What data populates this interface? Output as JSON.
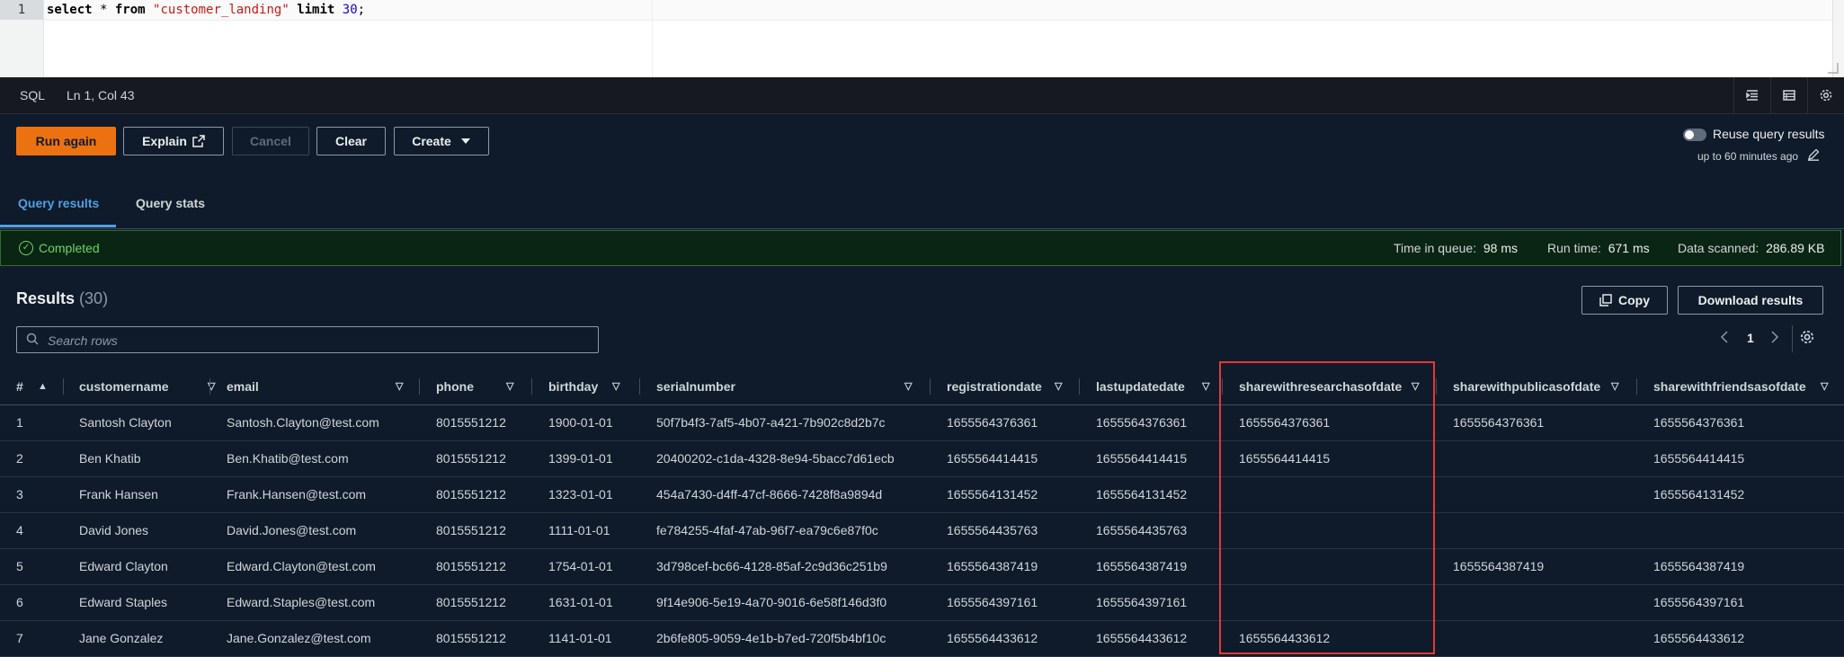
{
  "editor": {
    "line_number": "1",
    "code": {
      "kw1": "select",
      "star": " * ",
      "kw2": "from",
      "space1": " ",
      "table": "\"customer_landing\"",
      "space2": " ",
      "kw3": "limit",
      "space3": " ",
      "num": "30",
      "semi": ";"
    }
  },
  "statusbar": {
    "language": "SQL",
    "position": "Ln 1, Col 43",
    "icons": [
      "indent-icon",
      "table-icon",
      "settings-icon"
    ]
  },
  "toolbar": {
    "run_again": "Run again",
    "explain": "Explain",
    "cancel": "Cancel",
    "clear": "Clear",
    "create": "Create",
    "reuse_label": "Reuse query results",
    "reuse_sub": "up to 60 minutes ago"
  },
  "tabs": [
    {
      "label": "Query results",
      "active": true
    },
    {
      "label": "Query stats",
      "active": false
    }
  ],
  "status": {
    "label": "Completed",
    "queue_label": "Time in queue:",
    "queue_value": "98 ms",
    "run_label": "Run time:",
    "run_value": "671 ms",
    "scanned_label": "Data scanned:",
    "scanned_value": "286.89 KB"
  },
  "results": {
    "title": "Results",
    "count": "(30)",
    "copy": "Copy",
    "download": "Download results",
    "search_placeholder": "Search rows",
    "page": "1"
  },
  "table": {
    "columns": [
      "#",
      "customername",
      "email",
      "phone",
      "birthday",
      "serialnumber",
      "registrationdate",
      "lastupdatedate",
      "sharewithresearchasofdate",
      "sharewithpublicasofdate",
      "sharewithfriendsasofdate"
    ],
    "rows": [
      [
        "1",
        "Santosh Clayton",
        "Santosh.Clayton@test.com",
        "8015551212",
        "1900-01-01",
        "50f7b4f3-7af5-4b07-a421-7b902c8d2b7c",
        "1655564376361",
        "1655564376361",
        "1655564376361",
        "1655564376361",
        "1655564376361"
      ],
      [
        "2",
        "Ben Khatib",
        "Ben.Khatib@test.com",
        "8015551212",
        "1399-01-01",
        "20400202-c1da-4328-8e94-5bacc7d61ecb",
        "1655564414415",
        "1655564414415",
        "1655564414415",
        "",
        "1655564414415"
      ],
      [
        "3",
        "Frank Hansen",
        "Frank.Hansen@test.com",
        "8015551212",
        "1323-01-01",
        "454a7430-d4ff-47cf-8666-7428f8a9894d",
        "1655564131452",
        "1655564131452",
        "",
        "",
        "1655564131452"
      ],
      [
        "4",
        "David Jones",
        "David.Jones@test.com",
        "8015551212",
        "1111-01-01",
        "fe784255-4faf-47ab-96f7-ea79c6e87f0c",
        "1655564435763",
        "1655564435763",
        "",
        "",
        ""
      ],
      [
        "5",
        "Edward Clayton",
        "Edward.Clayton@test.com",
        "8015551212",
        "1754-01-01",
        "3d798cef-bc66-4128-85af-2c9d36c251b9",
        "1655564387419",
        "1655564387419",
        "",
        "1655564387419",
        "1655564387419"
      ],
      [
        "6",
        "Edward Staples",
        "Edward.Staples@test.com",
        "8015551212",
        "1631-01-01",
        "9f14e906-5e19-4a70-9016-6e58f146d3f0",
        "1655564397161",
        "1655564397161",
        "",
        "",
        "1655564397161"
      ],
      [
        "7",
        "Jane Gonzalez",
        "Jane.Gonzalez@test.com",
        "8015551212",
        "1141-01-01",
        "2b6fe805-9059-4e1b-b7ed-720f5b4bf10c",
        "1655564433612",
        "1655564433612",
        "1655564433612",
        "",
        "1655564433612"
      ]
    ]
  },
  "colors": {
    "accent": "#ec7211",
    "tab_active": "#539fe5",
    "success": "#6bd46a",
    "highlight": "#e53935"
  }
}
